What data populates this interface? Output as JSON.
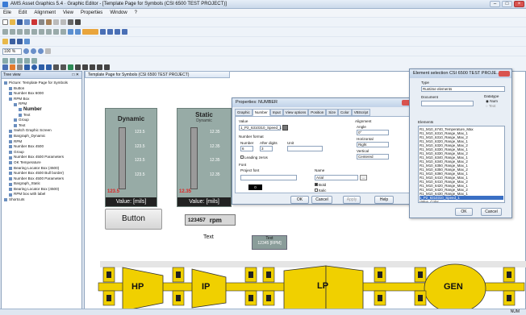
{
  "window": {
    "title": "AMS Asset Graphics 5.4 · Graphic Editor - [Template Page for Symbols (CSI 6500 TEST PROJECT)]"
  },
  "menu": [
    "Eile",
    "Edit",
    "Alignment",
    "View",
    "Properties",
    "Window",
    "?"
  ],
  "toolbar": {
    "zoom": "100 %"
  },
  "tree": {
    "title": "Tree view",
    "items": [
      "Picture: Template Page for Symbols",
      "Button",
      "Number Box 6000",
      "RPM Box",
      "RPM",
      "Number",
      "Text",
      "Group",
      "Text",
      "Switch Graphic Screen",
      "Bargraph_Dynamic",
      "RPM",
      "Number Box 4500",
      "Group",
      "Number Box 4500 Parameters",
      "OK Temperature",
      "Bearing Locator Box (4500)",
      "Number Box 4500 Bull border)",
      "Number Box 4500 Parameters",
      "Bargraph_Static",
      "Bearing Locator Box (4500)",
      "RPM box with label",
      "Shortcuts"
    ]
  },
  "doc_tab": "Template Page for Symbols (CSI 6500 TEST PROJECT)",
  "gauges": [
    {
      "title": "Dynamic",
      "subtitle": "",
      "ticks": [
        "123.5",
        "123.5",
        "123.5",
        "123.5"
      ],
      "red": "123.5",
      "value_label": "Value: [mils]"
    },
    {
      "title": "Static",
      "subtitle": "Dynamic",
      "ticks": [
        "12.35",
        "12.35",
        "12.35",
        "12.35"
      ],
      "red": "12.35",
      "value_label": "Value: [mils]"
    }
  ],
  "canvas": {
    "button_label": "Button",
    "rpm_value": "123457",
    "rpm_unit": "rpm",
    "text_label": "Text",
    "text_box_title": "Text",
    "text_box_value": "12345 [RPM]",
    "machine": [
      "HP",
      "IP",
      "LP",
      "GEN"
    ]
  },
  "properties_dialog": {
    "title": "Properties: NUMBER",
    "tabs": [
      "Graphic",
      "Number",
      "Input",
      "View options",
      "Position",
      "Size",
      "Color",
      "VBScript"
    ],
    "value_label": "Value",
    "value": "1_P2_6310310_Speed_1",
    "number_format": "Number format",
    "number_label": "Number",
    "number_value": "6",
    "after_digits_label": "After digits",
    "after_digits_value": "3",
    "unit_label": "Unit",
    "leading_zeros": "Leading zeros",
    "alignment": "Alignment",
    "angle_label": "Angle",
    "angle_value": "0°",
    "horizontal_label": "Horizontal",
    "horizontal_value": "Right",
    "vertical_label": "Vertical",
    "vertical_value": "Centered",
    "font_label": "Font",
    "project_font_label": "Project font",
    "project_font_value": "0",
    "name_label": "Name",
    "name_value": "Arial",
    "bold": "Bold",
    "italic": "Italic",
    "ok": "OK",
    "cancel": "Cancel",
    "apply": "Apply",
    "help": "Help"
  },
  "element_dialog": {
    "title": "Element selection CSI 6500 TEST PROJE...",
    "type_label": "Type",
    "type_value": "Runtime elements",
    "document_label": "Document",
    "datatype_label": "Datatype",
    "datatype_num": "Num",
    "datatype_text": "Text",
    "elements_label": "Elements",
    "elements": [
      "R1_M10_6740_Temperature_Max",
      "R1_M10_6310_Range_Max_1",
      "R1_M10_6310_Range_Max_2",
      "R1_M10_6320_Range_Max_1",
      "R1_M10_6320_Range_Max_2",
      "R1_M10_6330_Range_Max_1",
      "R1_M10_6330_Range_Max_2",
      "R1_M10_6340_Range_Max_1",
      "R1_M10_6340_Range_Max_2",
      "R1_M10_6350_Range_Max_1",
      "R1_M10_6350_Range_Max_2",
      "R1_M10_6360_Range_Max_1",
      "R1_M10_6410_Range_Max_1",
      "R1_M10_6410_Range_Max_2",
      "R1_M10_6420_Range_Max_1",
      "R1_M10_6420_Range_Max_2",
      "R1_M10_6430_Range_Max_1",
      "1_P2_6310310_Speed_1",
      "Value_Color"
    ],
    "selected_index": 17,
    "ok": "OK",
    "cancel": "Cancel"
  },
  "status": "NUM"
}
